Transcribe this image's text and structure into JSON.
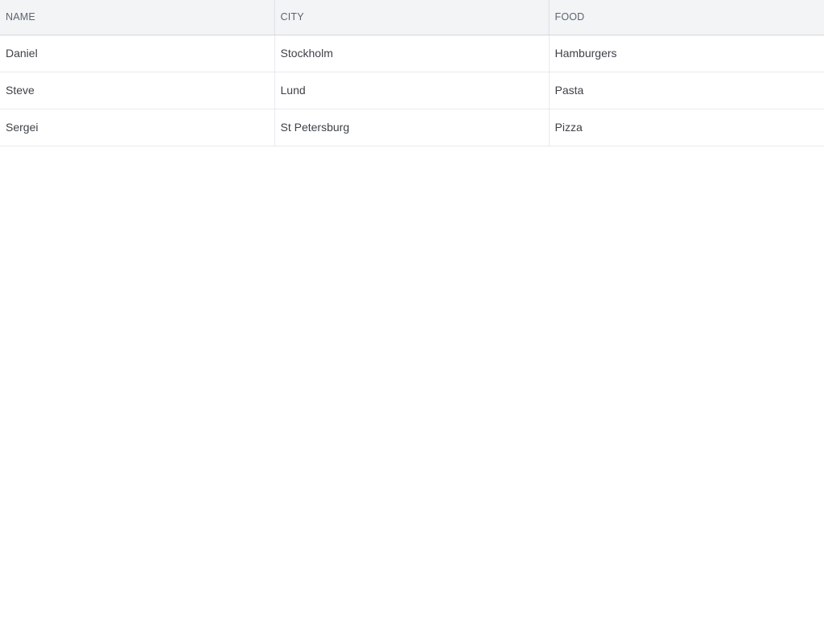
{
  "table": {
    "columns": [
      "NAME",
      "CITY",
      "FOOD"
    ],
    "rows": [
      [
        "Daniel",
        "Stockholm",
        "Hamburgers"
      ],
      [
        "Steve",
        "Lund",
        "Pasta"
      ],
      [
        "Sergei",
        "St Petersburg",
        "Pizza"
      ]
    ]
  }
}
